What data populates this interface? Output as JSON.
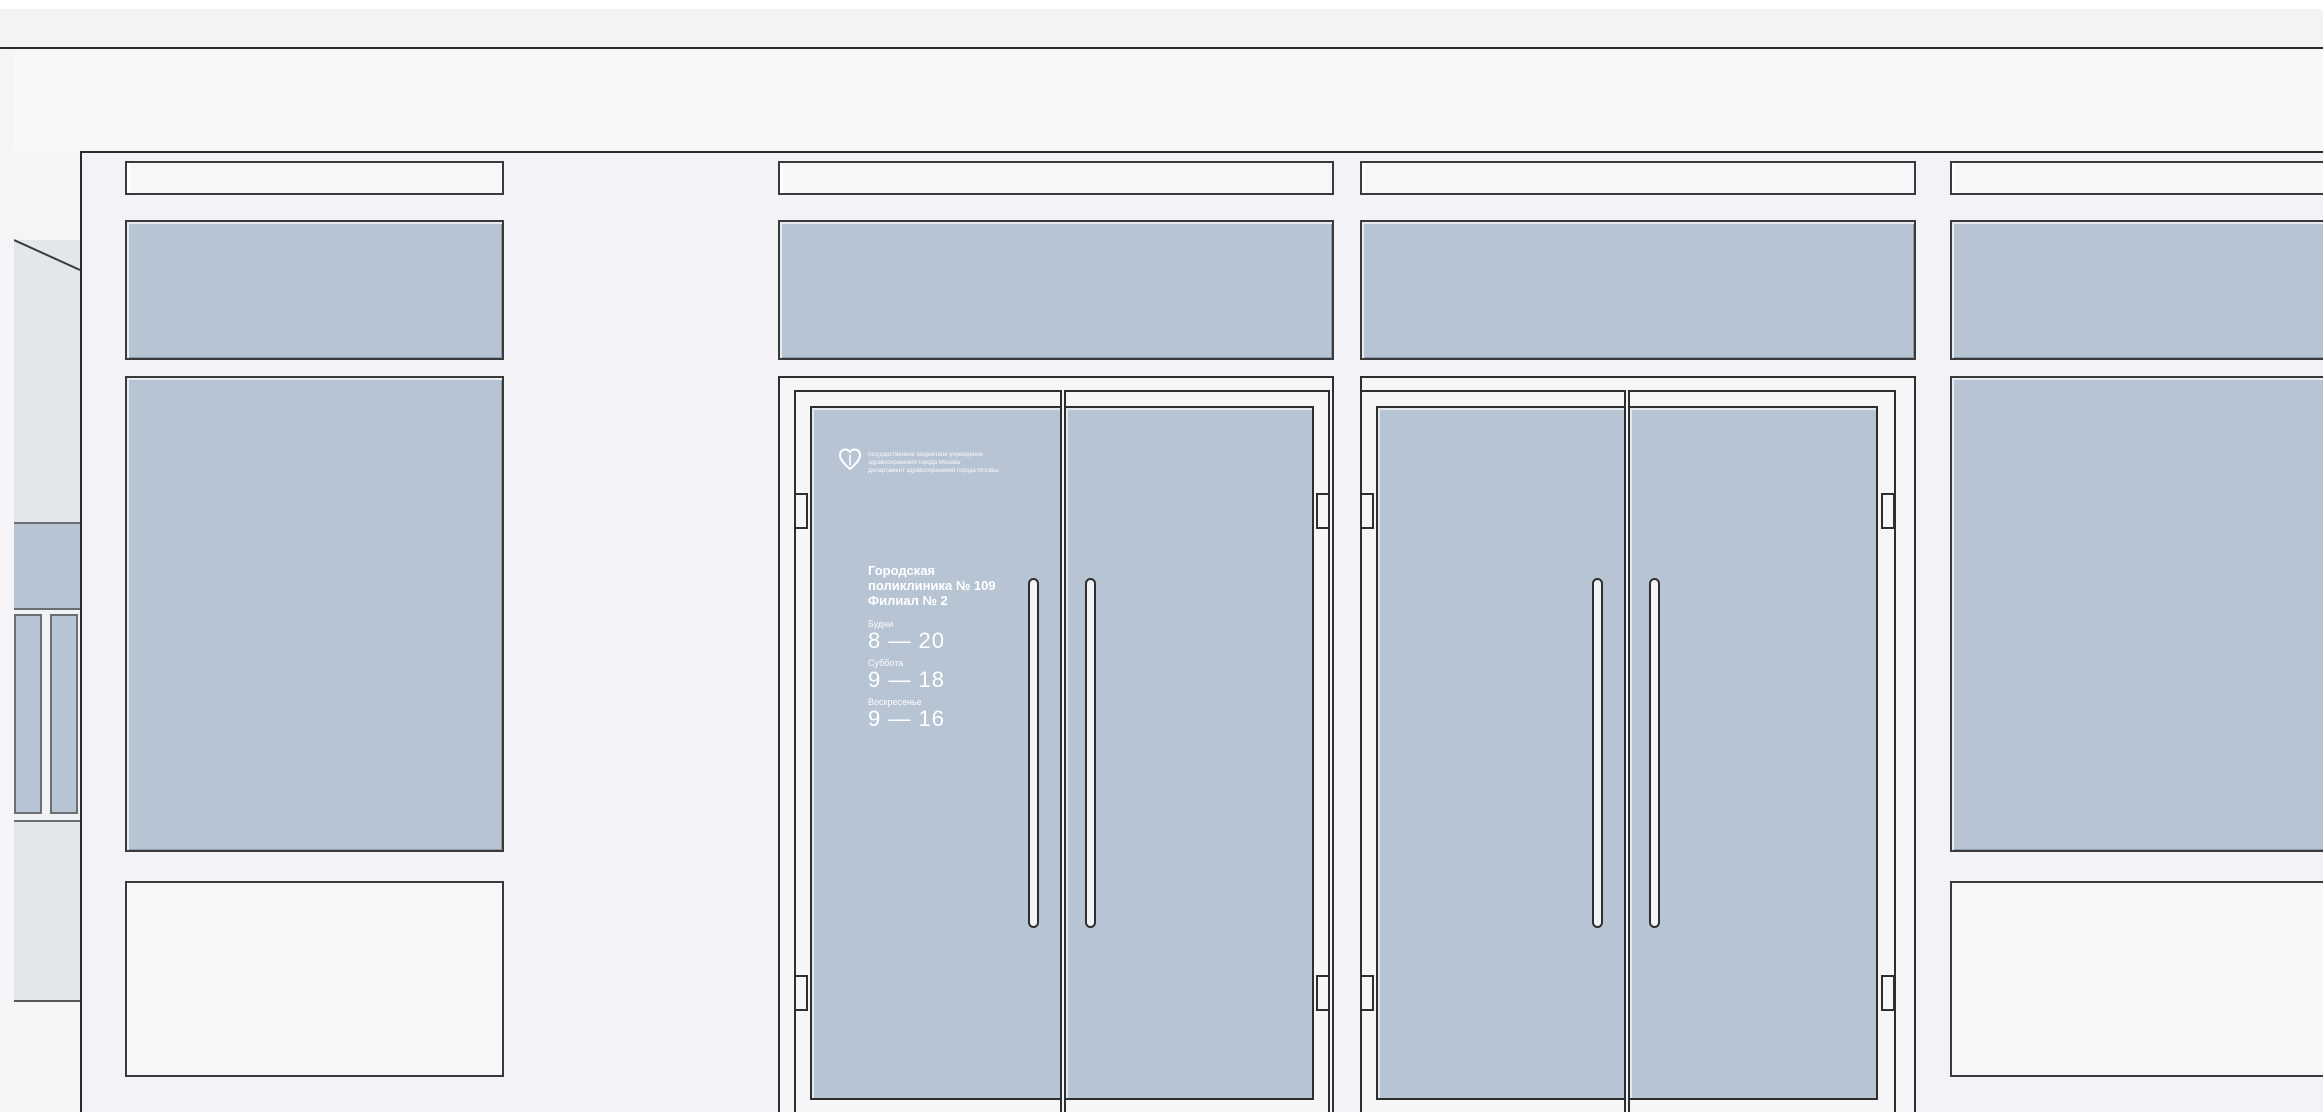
{
  "elevation": {
    "logo": {
      "icon": "heart-shield-icon",
      "lines": [
        "государственное бюджетное учреждение",
        "здравоохранения города Москвы",
        "Департамент здравоохранения города Москвы"
      ]
    },
    "clinic_name_lines": [
      "Городская",
      "поликлиника № 109",
      "Филиал № 2"
    ],
    "schedule": [
      {
        "label": "Будни",
        "hours": "8 — 20"
      },
      {
        "label": "Суббота",
        "hours": "9 — 18"
      },
      {
        "label": "Воскресенье",
        "hours": "9 — 16"
      }
    ]
  },
  "colors": {
    "glass": "#b7c4d4",
    "frame": "#2e2e2e",
    "wall": "#f3f3f7",
    "adjacent_wall": "#e3e6ea"
  }
}
